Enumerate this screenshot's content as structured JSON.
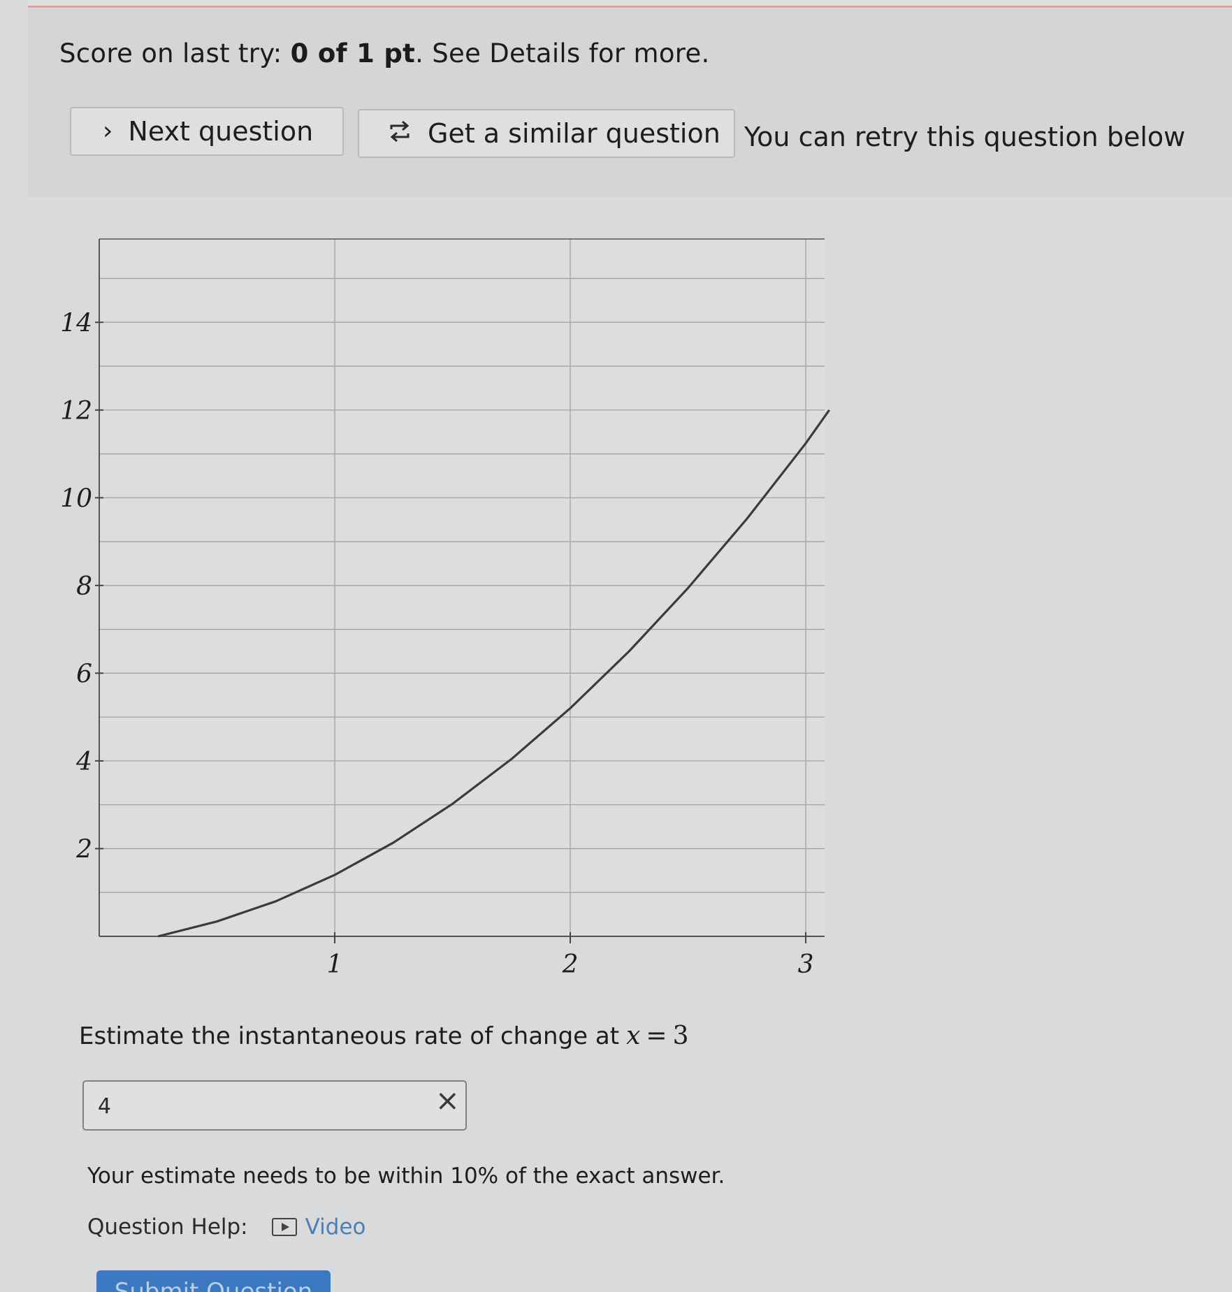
{
  "score": {
    "prefix": "Score on last try: ",
    "value": "0 of 1 pt",
    "suffix": ". See Details for more."
  },
  "actions": {
    "next_label": "Next question",
    "similar_label": "Get a similar question",
    "retry_note": "You can retry this question below"
  },
  "chart_data": {
    "type": "line",
    "title": "",
    "xlabel": "",
    "ylabel": "",
    "xlim": [
      0,
      3.08
    ],
    "ylim": [
      0,
      15.9
    ],
    "x_ticks": [
      1,
      2,
      3
    ],
    "x_tick_labels": [
      "1",
      "2",
      "3"
    ],
    "y_ticks": [
      2,
      4,
      6,
      8,
      10,
      12,
      14
    ],
    "y_tick_labels": [
      "2",
      "4",
      "6",
      "8",
      "10",
      "12",
      "14"
    ],
    "grid": true,
    "series": [
      {
        "x": [
          0.25,
          0.5,
          0.75,
          1.0,
          1.25,
          1.5,
          1.75,
          2.0,
          2.25,
          2.5,
          2.75,
          3.0,
          3.1
        ],
        "y": [
          0.0,
          0.34,
          0.8,
          1.4,
          2.14,
          3.02,
          4.04,
          5.2,
          6.5,
          7.94,
          9.52,
          11.24,
          12.0
        ]
      }
    ]
  },
  "question": {
    "prompt": "Estimate the instantaneous rate of change at",
    "math_var": "x",
    "math_eq": "=",
    "math_val": "3"
  },
  "answer": {
    "value": "4",
    "status_mark": "×"
  },
  "hint": "Your estimate needs to be within 10% of the exact answer.",
  "help": {
    "label": "Question Help:",
    "video_label": "Video"
  },
  "submit_label": "Submit Question",
  "colors": {
    "link": "#4e7fb3",
    "submit": "#3b78bf",
    "panel": "#d4d5d6"
  }
}
